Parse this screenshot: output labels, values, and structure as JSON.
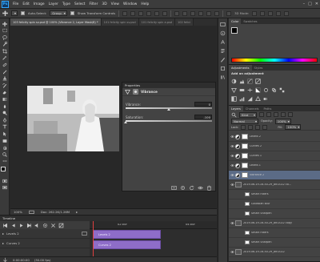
{
  "app": {
    "logo": "Ps"
  },
  "menu": [
    "File",
    "Edit",
    "Image",
    "Layer",
    "Type",
    "Select",
    "Filter",
    "3D",
    "View",
    "Window",
    "Help"
  ],
  "window_controls": [
    "–",
    "□",
    "✕"
  ],
  "options": {
    "auto_select_label": "Auto-Select:",
    "auto_select_value": "Group",
    "show_transform_label": "Show Transform Controls"
  },
  "doc_tabs": [
    "103 felicity spin sv.psd @ 100% (Vibrance 2, Layer Mask/8) *",
    "101 felicity spin sv.psd",
    "101 felicity spin a.psd",
    "102 felici"
  ],
  "properties": {
    "header": "Properties",
    "title": "Vibrance",
    "vibrance_label": "Vibrance:",
    "vibrance_value": "0",
    "saturation_label": "Saturation:",
    "saturation_value": "-100",
    "vibrance_level": 0.5,
    "saturation_level": 0.0
  },
  "status": {
    "zoom": "100%",
    "doc": "Doc: 262.2K/1.26M"
  },
  "timeline": {
    "header": "Timeline",
    "time": "0:00:00:00",
    "fps": "(30.00 fps)",
    "ruler_label": "02:00f",
    "ruler_label2": "04:00f",
    "layers": [
      "Levels 2",
      "Curves 2"
    ],
    "clips": [
      "Levels 2",
      "Curves 2"
    ]
  },
  "color_panel": {
    "tabs": [
      "Color",
      "Swatches"
    ]
  },
  "adjustments": {
    "tabs": [
      "Adjustments",
      "Styles"
    ],
    "subtitle": "Add an adjustment"
  },
  "layers_panel": {
    "tabs": [
      "Layers",
      "Channels",
      "Paths"
    ],
    "kind": "Kind",
    "blend": "Normal",
    "opacity_label": "Opacity:",
    "opacity": "100%",
    "lock_label": "Lock:",
    "fill_label": "Fill:",
    "fill": "100%",
    "rows": [
      {
        "name": "Levels 2",
        "kind": "adj",
        "selected": false
      },
      {
        "name": "Curves 2",
        "kind": "adj",
        "selected": false
      },
      {
        "name": "Curves 1",
        "kind": "adj",
        "selected": false
      },
      {
        "name": "Levels 1",
        "kind": "adj",
        "selected": false
      },
      {
        "name": "Vibrance 2",
        "kind": "adj",
        "selected": true
      },
      {
        "name": "2019-06-19-16-50-29_ani1022 co...",
        "kind": "smart",
        "selected": false
      },
      {
        "name": "Smart Filters",
        "kind": "sub",
        "selected": false
      },
      {
        "name": "Gaussian Blur",
        "kind": "sub",
        "selected": false
      },
      {
        "name": "Smart Sharpen",
        "kind": "sub",
        "selected": false
      },
      {
        "name": "2019-06-19-16-50-29_ani1022 copy",
        "kind": "smart",
        "selected": false
      },
      {
        "name": "Smart Filters",
        "kind": "sub",
        "selected": false
      },
      {
        "name": "Smart Sharpen",
        "kind": "sub",
        "selected": false
      },
      {
        "name": "2019-06-19-16-50-29_ani1022",
        "kind": "smart",
        "selected": false
      }
    ]
  },
  "colors": {
    "clip": "#8e6dc8",
    "selected": "#5b6b86",
    "accent": "#31a8ff"
  }
}
